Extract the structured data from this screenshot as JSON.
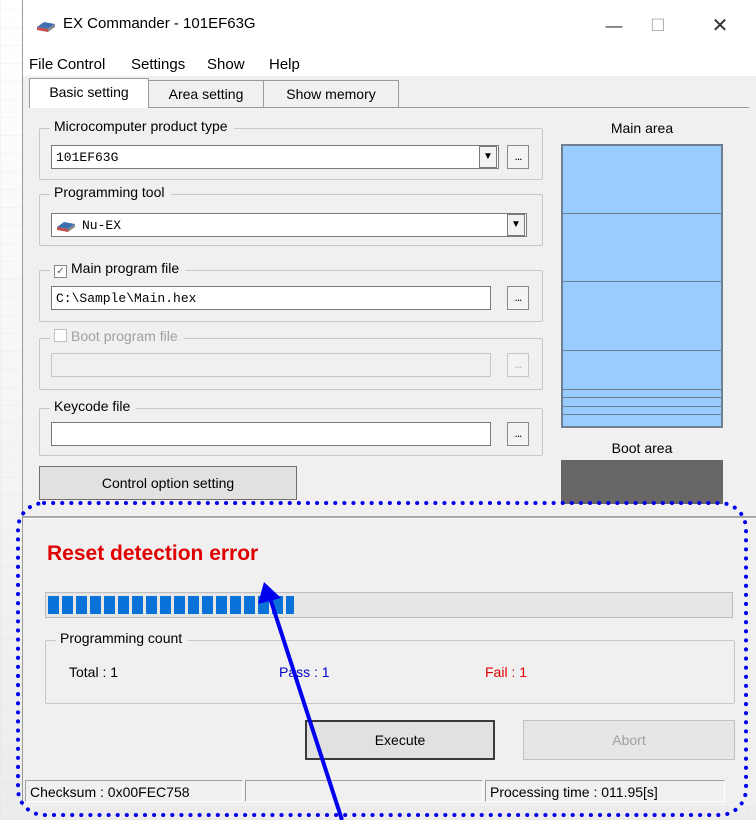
{
  "window": {
    "title": "EX Commander - 101EF63G"
  },
  "menu": {
    "items": [
      {
        "label": "File"
      },
      {
        "label": "Control"
      },
      {
        "label": "Settings"
      },
      {
        "label": "Show"
      },
      {
        "label": "Help"
      }
    ]
  },
  "tabs": [
    {
      "label": "Basic setting",
      "active": true
    },
    {
      "label": "Area setting",
      "active": false
    },
    {
      "label": "Show memory",
      "active": false
    }
  ],
  "product": {
    "legend": "Microcomputer product type",
    "value": "101EF63G"
  },
  "tool": {
    "legend": "Programming tool",
    "value": "Nu-EX"
  },
  "main_program": {
    "legend": "Main program file",
    "checked": true,
    "value": "C:\\Sample\\Main.hex"
  },
  "boot_program": {
    "legend": "Boot program file",
    "checked": false,
    "value": ""
  },
  "keycode": {
    "legend": "Keycode file",
    "value": ""
  },
  "ellipsis_label": "...",
  "control_option_label": "Control option setting",
  "areas": {
    "main_label": "Main area",
    "boot_label": "Boot area",
    "main_color": "#99ccff",
    "boot_color": "#666666"
  },
  "status": {
    "message": "Reset detection error",
    "color": "#e00000"
  },
  "progress": {
    "fraction": 0.36,
    "color": "#0a73da"
  },
  "counts": {
    "legend": "Programming count",
    "total": "Total  : 1",
    "pass": "Pass   : 1",
    "fail": "Fail   : 1",
    "pass_color": "#0000cc",
    "fail_color": "#e00000"
  },
  "buttons": {
    "execute": "Execute",
    "abort": "Abort"
  },
  "statusbar": {
    "checksum": "Checksum : 0x00FEC758",
    "processing_time": "Processing time :  011.95[s]"
  },
  "annotation": {
    "outline_color": "#0000ee",
    "arrow_color": "#0000ee"
  }
}
